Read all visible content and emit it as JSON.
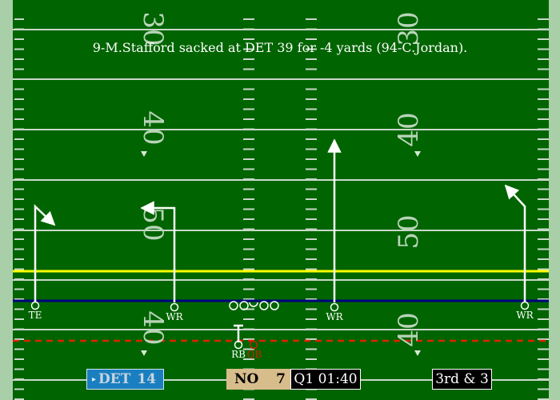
{
  "play": {
    "description": "9-M.Stafford sacked at DET 39 for -4 yards (94-C.Jordan)."
  },
  "field": {
    "yard_numbers": {
      "top": [
        "30",
        "30"
      ],
      "upper": [
        "40",
        "40"
      ],
      "middle": [
        "50",
        "50"
      ],
      "lower": [
        "40",
        "40"
      ]
    },
    "colors": {
      "grass": "#006400",
      "sideline": "#a9cfa9",
      "first_down_line": "#ffff00",
      "scrimmage_line": "#000080",
      "defense_line": "#dd2200",
      "yard_numbers": "#b8d4b8"
    }
  },
  "players": {
    "offense": [
      {
        "label": "TE"
      },
      {
        "label": "WR"
      },
      {
        "label": "WR"
      },
      {
        "label": "WR"
      },
      {
        "label": "RB"
      }
    ],
    "qb": {
      "label": "QB"
    }
  },
  "scoreboard": {
    "possession_arrow": "▸",
    "home": {
      "team": "DET",
      "score": "14"
    },
    "away": {
      "team": "NO",
      "score": "7"
    },
    "clock": "Q1 01:40",
    "down_distance": "3rd & 3"
  }
}
